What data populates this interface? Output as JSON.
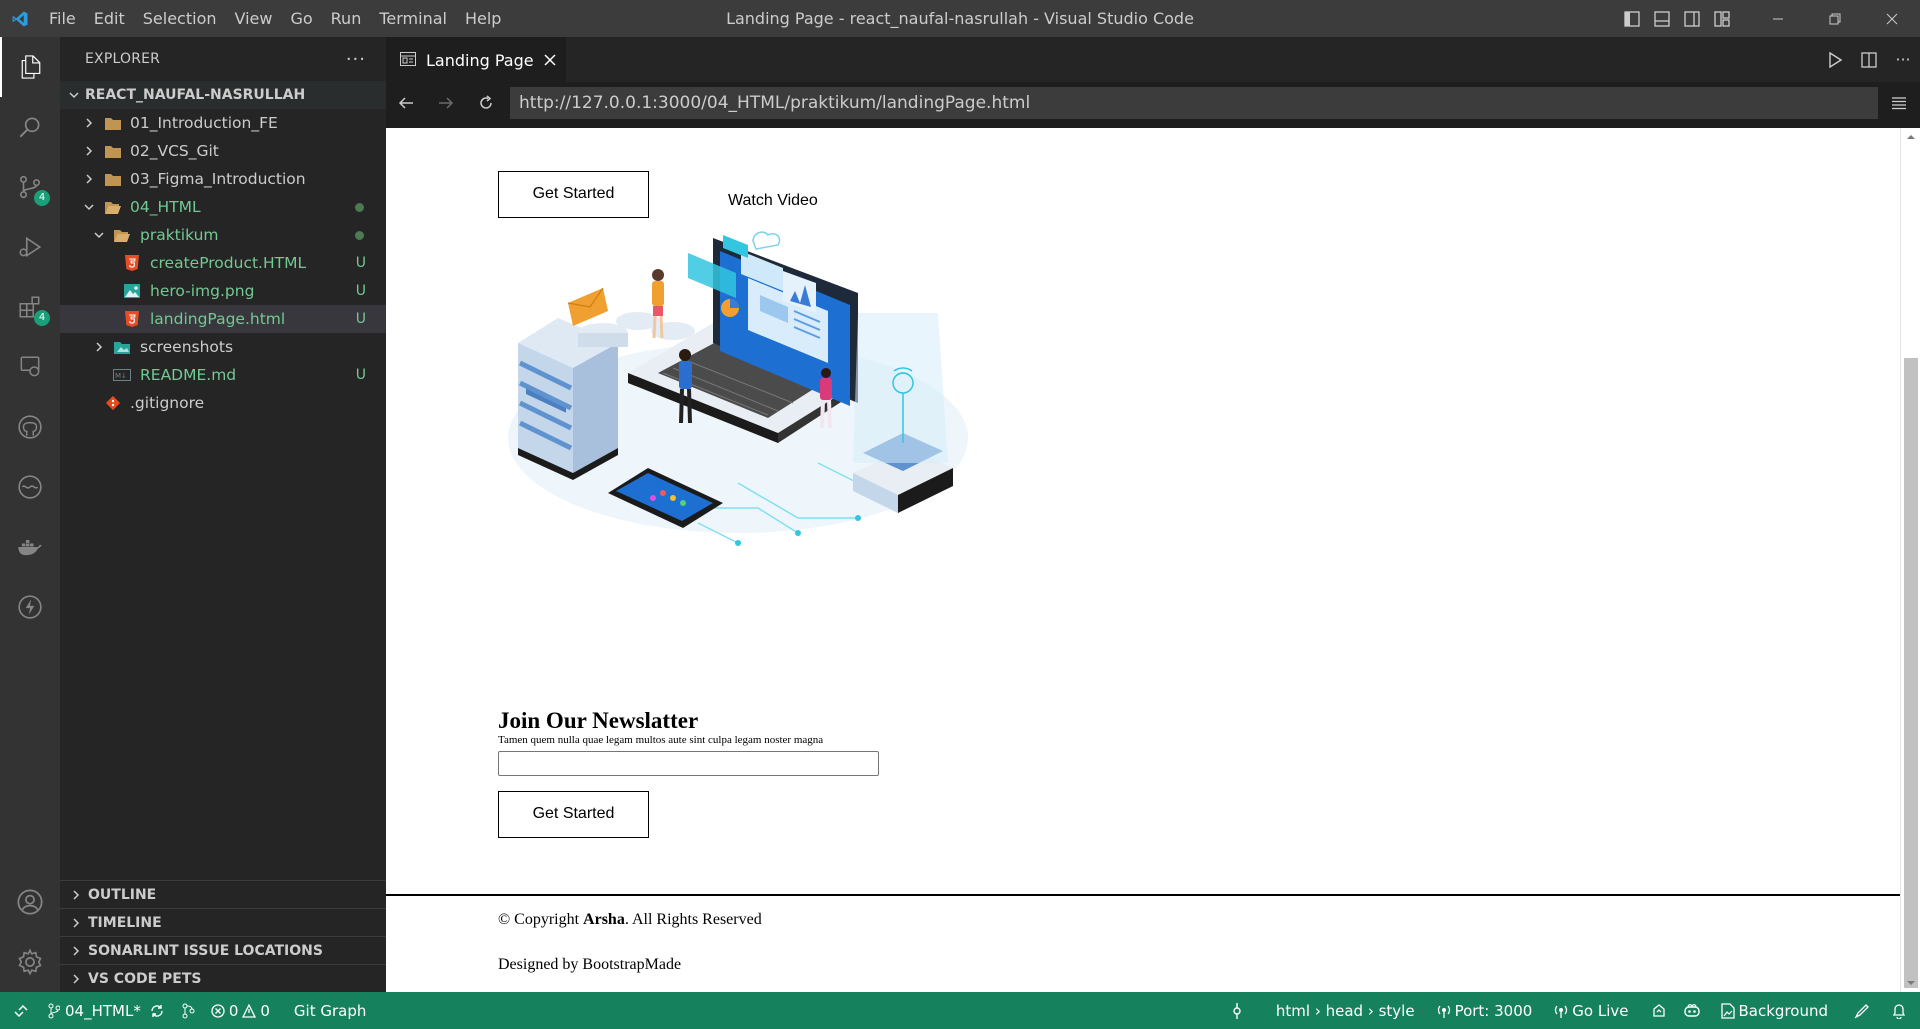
{
  "window": {
    "title": "Landing Page - react_naufal-nasrullah - Visual Studio Code",
    "menu": [
      "File",
      "Edit",
      "Selection",
      "View",
      "Go",
      "Run",
      "Terminal",
      "Help"
    ]
  },
  "activity": {
    "scm_badge": "4",
    "extensions_badge": "4"
  },
  "explorer": {
    "title": "EXPLORER",
    "root": "REACT_NAUFAL-NASRULLAH",
    "items": [
      {
        "label": "01_Introduction_FE",
        "status": ""
      },
      {
        "label": "02_VCS_Git",
        "status": ""
      },
      {
        "label": "03_Figma_Introduction",
        "status": ""
      },
      {
        "label": "04_HTML",
        "status": ""
      },
      {
        "label": "praktikum",
        "status": ""
      },
      {
        "label": "createProduct.HTML",
        "status": "U"
      },
      {
        "label": "hero-img.png",
        "status": "U"
      },
      {
        "label": "landingPage.html",
        "status": "U"
      },
      {
        "label": "screenshots",
        "status": ""
      },
      {
        "label": "README.md",
        "status": "U"
      },
      {
        "label": ".gitignore",
        "status": ""
      }
    ],
    "sections": [
      "OUTLINE",
      "TIMELINE",
      "SONARLINT ISSUE LOCATIONS",
      "VS CODE PETS"
    ]
  },
  "editor": {
    "tab_label": "Landing Page",
    "url": "http://127.0.0.1:3000/04_HTML/praktikum/landingPage.html"
  },
  "webpage": {
    "get_started_top": "Get Started",
    "watch_video": "Watch Video",
    "newsletter_title": "Join Our Newslatter",
    "newsletter_text": "Tamen quem nulla quae legam multos aute sint culpa legam noster magna",
    "get_started_bottom": "Get Started",
    "copyright_prefix": "© Copyright ",
    "copyright_brand": "Arsha",
    "copyright_suffix": ". All Rights Reserved",
    "designed_by": "Designed by BootstrapMade"
  },
  "statusbar": {
    "branch": "04_HTML*",
    "errors": "0",
    "warnings": "0",
    "git_graph": "Git Graph",
    "breadcrumb": "html › head › style",
    "port": "Port: 3000",
    "go_live": "Go Live",
    "background": "Background"
  },
  "colors": {
    "accent": "#16825d",
    "badge": "#1a9f79",
    "untracked": "#73c991",
    "html_icon": "#e44d26",
    "folder": "#c09553"
  }
}
